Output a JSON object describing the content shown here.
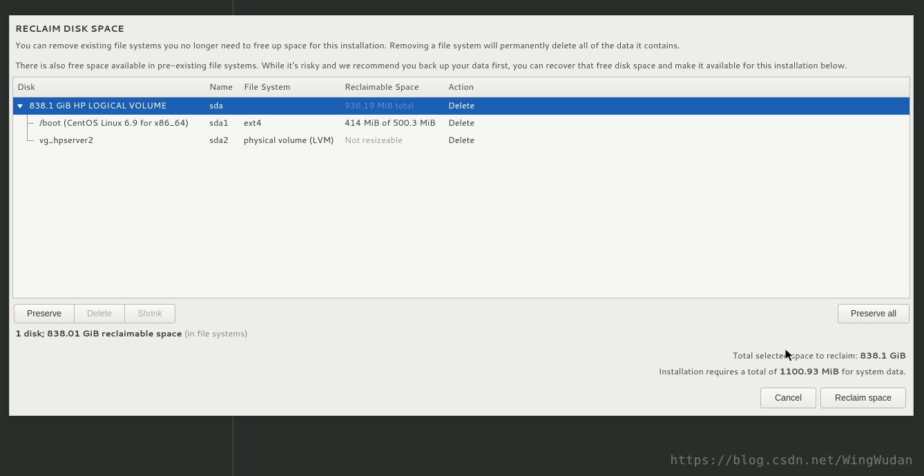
{
  "dialog": {
    "title": "RECLAIM DISK SPACE",
    "desc1": "You can remove existing file systems you no longer need to free up space for this installation.  Removing a file system will permanently delete all of the data it contains.",
    "desc2": "There is also free space available in pre-existing file systems.  While it's risky and we recommend you back up your data first, you can recover that free disk space and make it available for this installation below."
  },
  "table": {
    "columns": {
      "disk": "Disk",
      "name": "Name",
      "fs": "File System",
      "reclaim": "Reclaimable Space",
      "action": "Action"
    },
    "rows": [
      {
        "disk": "838.1 GiB HP LOGICAL VOLUME",
        "name": "sda",
        "fs": "",
        "reclaim": "936.19 MiB total",
        "action": "Delete",
        "selected": true,
        "parent": true
      },
      {
        "disk": "/boot (CentOS Linux 6.9 for x86_64)",
        "name": "sda1",
        "fs": "ext4",
        "reclaim": "414 MiB of 500.3 MiB",
        "action": "Delete",
        "child": true
      },
      {
        "disk": "vg_hpserver2",
        "name": "sda2",
        "fs": "physical volume (LVM)",
        "reclaim": "Not resizeable",
        "reclaim_muted": true,
        "action": "Delete",
        "child": true,
        "last": true
      }
    ]
  },
  "buttons": {
    "preserve": "Preserve",
    "delete": "Delete",
    "shrink": "Shrink",
    "preserve_all": "Preserve all",
    "cancel": "Cancel",
    "reclaim_space": "Reclaim space"
  },
  "summary": {
    "bold": "1 disk; 838.01 GiB reclaimable space",
    "suffix": " (in file systems)"
  },
  "footer": {
    "line1_pre": "Total selected space to reclaim: ",
    "line1_bold": "838.1 GiB",
    "line2_pre": "Installation requires a total of ",
    "line2_bold": "1100.93 MiB",
    "line2_suf": " for system data."
  },
  "watermark": "https://blog.csdn.net/WingWudan"
}
